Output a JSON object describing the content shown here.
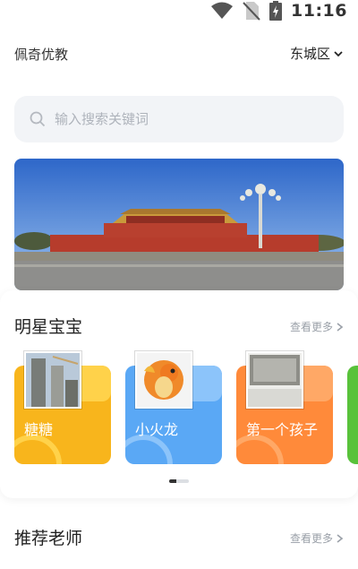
{
  "status_bar": {
    "time": "11:16"
  },
  "header": {
    "app_name": "佩奇优教",
    "location": "东城区"
  },
  "search": {
    "placeholder": "输入搜索关键词"
  },
  "star_babies": {
    "title": "明星宝宝",
    "see_more": "查看更多",
    "items": [
      {
        "name": "糖糖",
        "card_color": "#f8b51c"
      },
      {
        "name": "小火龙",
        "card_color": "#5aa8f5"
      },
      {
        "name": "第一个孩子",
        "card_color": "#ff8a3a"
      }
    ]
  },
  "recommended_teachers": {
    "title": "推荐老师",
    "see_more": "查看更多"
  },
  "colors": {
    "search_bg": "#f2f4f7",
    "muted_text": "#9aa0a8",
    "green_card": "#58c23a"
  }
}
